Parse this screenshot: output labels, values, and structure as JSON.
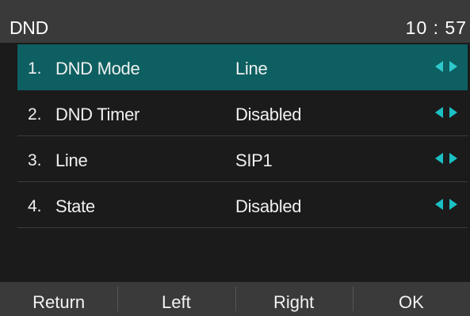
{
  "status": {
    "title": "DND",
    "time": "10 : 57"
  },
  "menu": {
    "items": [
      {
        "number": "1.",
        "label": "DND Mode",
        "value": "Line",
        "selected": true
      },
      {
        "number": "2.",
        "label": "DND Timer",
        "value": "Disabled",
        "selected": false
      },
      {
        "number": "3.",
        "label": "Line",
        "value": "SIP1",
        "selected": false
      },
      {
        "number": "4.",
        "label": "State",
        "value": "Disabled",
        "selected": false
      }
    ],
    "arrow_icons": [
      "triangle-left-icon",
      "triangle-right-icon"
    ]
  },
  "softkeys": {
    "return_label": "Return",
    "left_label": "Left",
    "right_label": "Right",
    "ok_label": "OK"
  },
  "colors": {
    "selection": "#0d5f61",
    "arrow": "#1ac0c4",
    "background": "#1b1b1b",
    "bar": "#3a3a3a"
  }
}
